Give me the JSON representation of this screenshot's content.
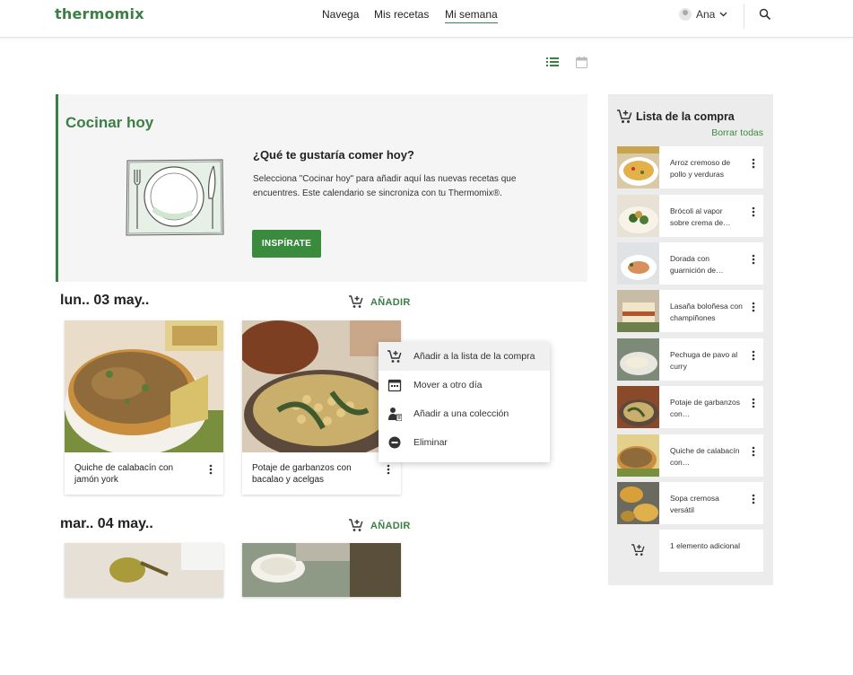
{
  "header": {
    "logo": "thermomix",
    "nav": [
      {
        "label": "Navega"
      },
      {
        "label": "Mis recetas"
      },
      {
        "label": "Mi semana",
        "active": true
      }
    ],
    "user_name": "Ana",
    "icons": {
      "user": "avatar-icon",
      "search": "search-icon"
    }
  },
  "view_toggle": {
    "list_icon": "list-view-icon",
    "calendar_icon": "calendar-view-icon",
    "active": "list"
  },
  "cocinar_hoy": {
    "title": "Cocinar hoy",
    "question": "¿Qué te gustaría comer hoy?",
    "text": "Selecciona \"Cocinar hoy\" para añadir aquí las nuevas recetas que encuentres. Este calendario se sincroniza con tu Thermomix®.",
    "button": "INSPÍRATE"
  },
  "days": [
    {
      "title": "lun.. 03 may..",
      "add_label": "AÑADIR",
      "recipes": [
        {
          "name": "Quiche de calabacín con jamón york"
        },
        {
          "name": "Potaje de garbanzos con bacalao y acelgas"
        }
      ]
    },
    {
      "title": "mar.. 04 may..",
      "add_label": "AÑADIR",
      "recipes": []
    }
  ],
  "context_menu": {
    "items": [
      {
        "label": "Añadir a la lista de la compra",
        "icon": "cart-add-icon"
      },
      {
        "label": "Mover a otro día",
        "icon": "calendar-icon"
      },
      {
        "label": "Añadir a una colección",
        "icon": "collection-add-icon"
      },
      {
        "label": "Eliminar",
        "icon": "remove-circle-icon"
      }
    ]
  },
  "shopping_list": {
    "title": "Lista de la compra",
    "clear_all": "Borrar todas",
    "items": [
      {
        "label": "Arroz cremoso de pollo y verduras"
      },
      {
        "label": "Brócoli al vapor sobre crema de…"
      },
      {
        "label": "Dorada con guarnición de…"
      },
      {
        "label": "Lasaña boloñesa con champiñones"
      },
      {
        "label": "Pechuga de pavo al curry"
      },
      {
        "label": "Potaje de garbanzos con…"
      },
      {
        "label": "Quiche de calabacín con…"
      },
      {
        "label": "Sopa cremosa versátil"
      },
      {
        "label": "1 elemento adicional"
      }
    ]
  },
  "colors": {
    "brand_green": "#3b7f45",
    "button_green": "#3b8b3f",
    "panel_grey": "#f5f5f5",
    "sidebar_grey": "#ececec"
  }
}
